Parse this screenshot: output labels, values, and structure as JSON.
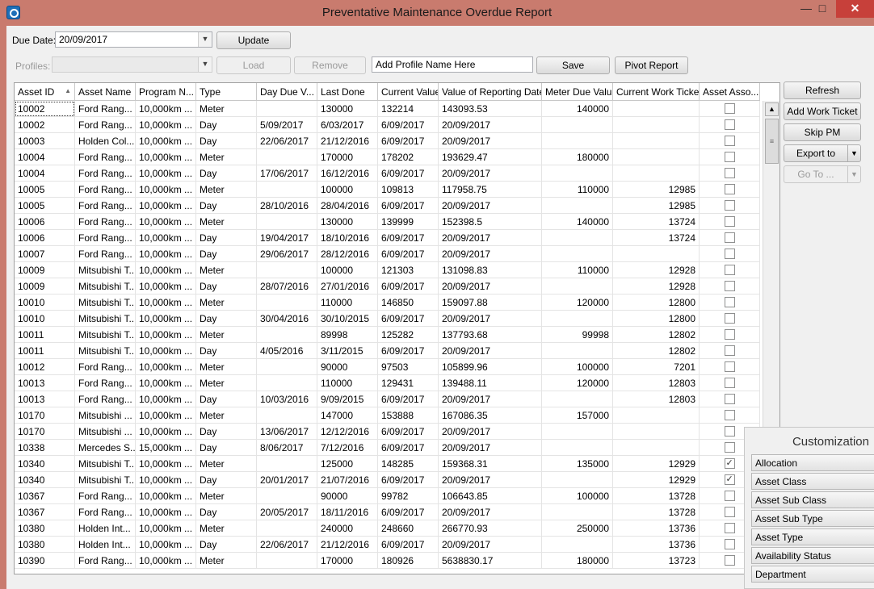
{
  "window": {
    "title": "Preventative Maintenance Overdue Report",
    "controls": {
      "minimize": "—",
      "maximize": "□",
      "close": "✕"
    }
  },
  "toolbar": {
    "due_date_label": "Due Date:",
    "due_date_value": "20/09/2017",
    "update_label": "Update",
    "profiles_label": "Profiles:",
    "profiles_value": "",
    "load_label": "Load",
    "remove_label": "Remove",
    "profile_name_value": "Add Profile Name Here",
    "save_label": "Save",
    "pivot_report_label": "Pivot Report"
  },
  "side_buttons": {
    "refresh": "Refresh",
    "add_work_ticket": "Add Work Ticket",
    "skip_pm": "Skip PM",
    "export_to": "Export to",
    "go_to": "Go To ..."
  },
  "grid": {
    "columns": [
      "Asset ID",
      "Asset Name",
      "Program N...",
      "Type",
      "Day Due V...",
      "Last Done",
      "Current Value",
      "Value of Reporting Date",
      "Meter Due Value",
      "Current Work Ticket",
      "Asset Asso..."
    ],
    "sort_indicator": "▲",
    "rows": [
      [
        "10002",
        "Ford Rang...",
        "10,000km ...",
        "Meter",
        "",
        "130000",
        "132214",
        "143093.53",
        "140000",
        "",
        false
      ],
      [
        "10002",
        "Ford Rang...",
        "10,000km ...",
        "Day",
        "5/09/2017",
        "6/03/2017",
        "6/09/2017",
        "20/09/2017",
        "",
        "",
        false
      ],
      [
        "10003",
        "Holden Col...",
        "10,000km ...",
        "Day",
        "22/06/2017",
        "21/12/2016",
        "6/09/2017",
        "20/09/2017",
        "",
        "",
        false
      ],
      [
        "10004",
        "Ford Rang...",
        "10,000km ...",
        "Meter",
        "",
        "170000",
        "178202",
        "193629.47",
        "180000",
        "",
        false
      ],
      [
        "10004",
        "Ford Rang...",
        "10,000km ...",
        "Day",
        "17/06/2017",
        "16/12/2016",
        "6/09/2017",
        "20/09/2017",
        "",
        "",
        false
      ],
      [
        "10005",
        "Ford Rang...",
        "10,000km ...",
        "Meter",
        "",
        "100000",
        "109813",
        "117958.75",
        "110000",
        "12985",
        false
      ],
      [
        "10005",
        "Ford Rang...",
        "10,000km ...",
        "Day",
        "28/10/2016",
        "28/04/2016",
        "6/09/2017",
        "20/09/2017",
        "",
        "12985",
        false
      ],
      [
        "10006",
        "Ford Rang...",
        "10,000km ...",
        "Meter",
        "",
        "130000",
        "139999",
        "152398.5",
        "140000",
        "13724",
        false
      ],
      [
        "10006",
        "Ford Rang...",
        "10,000km ...",
        "Day",
        "19/04/2017",
        "18/10/2016",
        "6/09/2017",
        "20/09/2017",
        "",
        "13724",
        false
      ],
      [
        "10007",
        "Ford Rang...",
        "10,000km ...",
        "Day",
        "29/06/2017",
        "28/12/2016",
        "6/09/2017",
        "20/09/2017",
        "",
        "",
        false
      ],
      [
        "10009",
        "Mitsubishi T...",
        "10,000km ...",
        "Meter",
        "",
        "100000",
        "121303",
        "131098.83",
        "110000",
        "12928",
        false
      ],
      [
        "10009",
        "Mitsubishi T...",
        "10,000km ...",
        "Day",
        "28/07/2016",
        "27/01/2016",
        "6/09/2017",
        "20/09/2017",
        "",
        "12928",
        false
      ],
      [
        "10010",
        "Mitsubishi T...",
        "10,000km ...",
        "Meter",
        "",
        "110000",
        "146850",
        "159097.88",
        "120000",
        "12800",
        false
      ],
      [
        "10010",
        "Mitsubishi T...",
        "10,000km ...",
        "Day",
        "30/04/2016",
        "30/10/2015",
        "6/09/2017",
        "20/09/2017",
        "",
        "12800",
        false
      ],
      [
        "10011",
        "Mitsubishi T...",
        "10,000km ...",
        "Meter",
        "",
        "89998",
        "125282",
        "137793.68",
        "99998",
        "12802",
        false
      ],
      [
        "10011",
        "Mitsubishi T...",
        "10,000km ...",
        "Day",
        "4/05/2016",
        "3/11/2015",
        "6/09/2017",
        "20/09/2017",
        "",
        "12802",
        false
      ],
      [
        "10012",
        "Ford Rang...",
        "10,000km ...",
        "Meter",
        "",
        "90000",
        "97503",
        "105899.96",
        "100000",
        "7201",
        false
      ],
      [
        "10013",
        "Ford Rang...",
        "10,000km ...",
        "Meter",
        "",
        "110000",
        "129431",
        "139488.11",
        "120000",
        "12803",
        false
      ],
      [
        "10013",
        "Ford Rang...",
        "10,000km ...",
        "Day",
        "10/03/2016",
        "9/09/2015",
        "6/09/2017",
        "20/09/2017",
        "",
        "12803",
        false
      ],
      [
        "10170",
        "Mitsubishi ...",
        "10,000km ...",
        "Meter",
        "",
        "147000",
        "153888",
        "167086.35",
        "157000",
        "",
        false
      ],
      [
        "10170",
        "Mitsubishi ...",
        "10,000km ...",
        "Day",
        "13/06/2017",
        "12/12/2016",
        "6/09/2017",
        "20/09/2017",
        "",
        "",
        false
      ],
      [
        "10338",
        "Mercedes S...",
        "15,000km ...",
        "Day",
        "8/06/2017",
        "7/12/2016",
        "6/09/2017",
        "20/09/2017",
        "",
        "",
        false
      ],
      [
        "10340",
        "Mitsubishi T...",
        "10,000km ...",
        "Meter",
        "",
        "125000",
        "148285",
        "159368.31",
        "135000",
        "12929",
        true
      ],
      [
        "10340",
        "Mitsubishi T...",
        "10,000km ...",
        "Day",
        "20/01/2017",
        "21/07/2016",
        "6/09/2017",
        "20/09/2017",
        "",
        "12929",
        true
      ],
      [
        "10367",
        "Ford Rang...",
        "10,000km ...",
        "Meter",
        "",
        "90000",
        "99782",
        "106643.85",
        "100000",
        "13728",
        false
      ],
      [
        "10367",
        "Ford Rang...",
        "10,000km ...",
        "Day",
        "20/05/2017",
        "18/11/2016",
        "6/09/2017",
        "20/09/2017",
        "",
        "13728",
        false
      ],
      [
        "10380",
        "Holden Int...",
        "10,000km ...",
        "Meter",
        "",
        "240000",
        "248660",
        "266770.93",
        "250000",
        "13736",
        false
      ],
      [
        "10380",
        "Holden Int...",
        "10,000km ...",
        "Day",
        "22/06/2017",
        "21/12/2016",
        "6/09/2017",
        "20/09/2017",
        "",
        "13736",
        false
      ],
      [
        "10390",
        "Ford Rang...",
        "10,000km ...",
        "Meter",
        "",
        "170000",
        "180926",
        "5638830.17",
        "180000",
        "13723",
        false
      ]
    ]
  },
  "customization": {
    "title": "Customization",
    "items": [
      "Allocation",
      "Asset Class",
      "Asset Sub Class",
      "Asset Sub Type",
      "Asset Type",
      "Availability Status",
      "Department"
    ]
  }
}
